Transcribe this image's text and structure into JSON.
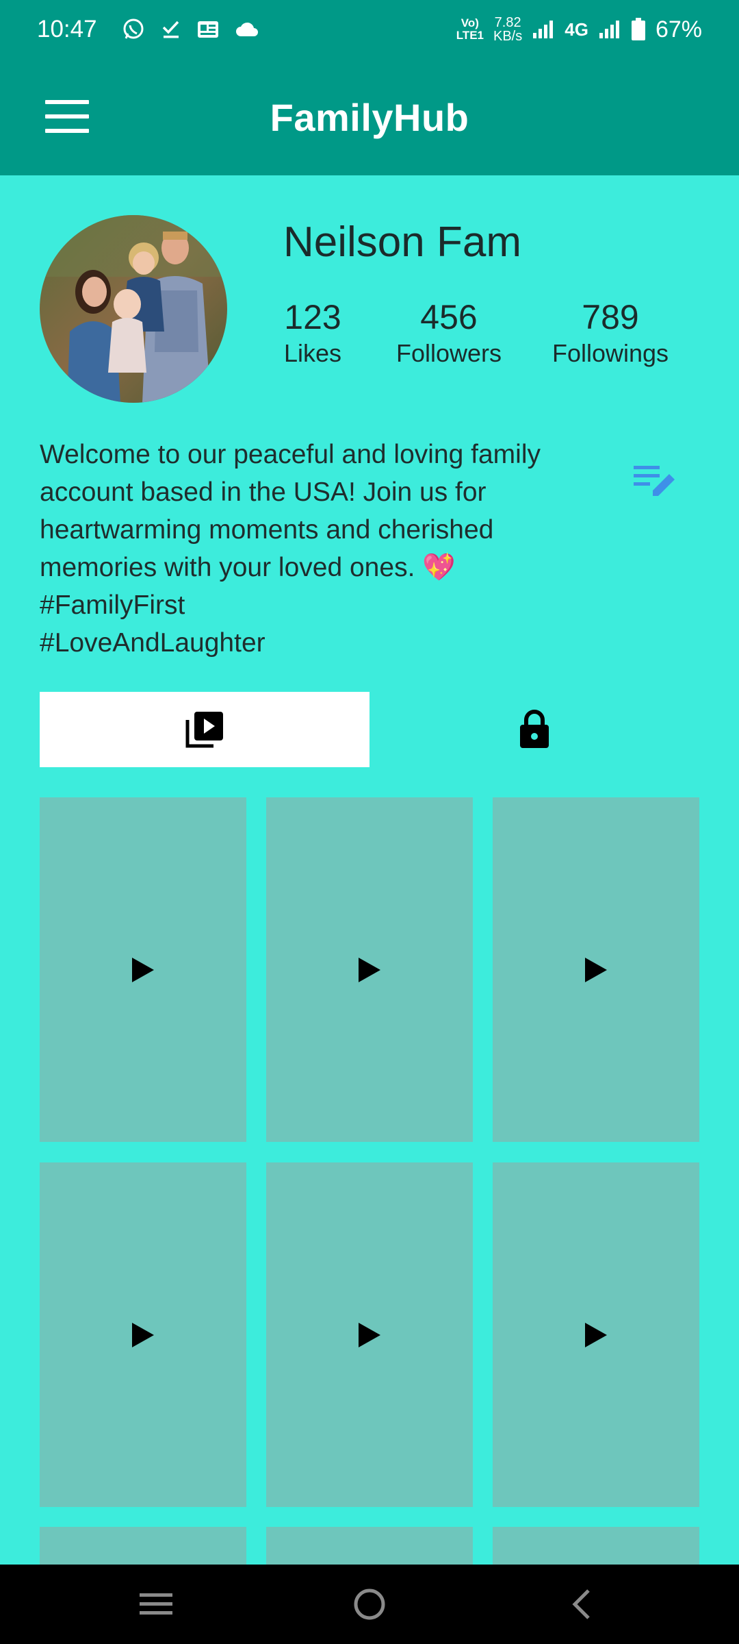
{
  "status_bar": {
    "time": "10:47",
    "net_top": "Vo)",
    "net_bottom": "LTE1",
    "speed_top": "7.82",
    "speed_bottom": "KB/s",
    "network_type": "4G",
    "battery": "67%",
    "icons": [
      "whatsapp-icon",
      "task-check-icon",
      "news-icon",
      "cloud-icon",
      "signal-icon",
      "battery-icon"
    ]
  },
  "app_bar": {
    "title": "FamilyHub",
    "menu_icon": "hamburger-menu-icon"
  },
  "profile": {
    "name": "Neilson Fam",
    "stats": [
      {
        "value": "123",
        "label": "Likes"
      },
      {
        "value": "456",
        "label": "Followers"
      },
      {
        "value": "789",
        "label": "Followings"
      }
    ],
    "bio_lines": [
      "Welcome to our peaceful and loving family",
      "account based in the USA! Join us for",
      "heartwarming moments and cherished",
      "memories with your loved ones. 💖",
      "#FamilyFirst",
      "#LoveAndLaughter"
    ],
    "edit_icon": "edit-note-icon"
  },
  "tabs": [
    {
      "name": "videos",
      "icon": "video-library-icon",
      "selected": true
    },
    {
      "name": "private",
      "icon": "lock-icon",
      "selected": false
    }
  ],
  "videos": {
    "count_visible_rows": 2,
    "icon": "play-icon"
  },
  "nav_bar": {
    "icons": [
      "recents-icon",
      "home-icon",
      "back-icon"
    ]
  },
  "colors": {
    "primary": "#009987",
    "background": "#3DECDC",
    "tile": "#6EC6BC",
    "edit_icon": "#3F8FE8"
  }
}
